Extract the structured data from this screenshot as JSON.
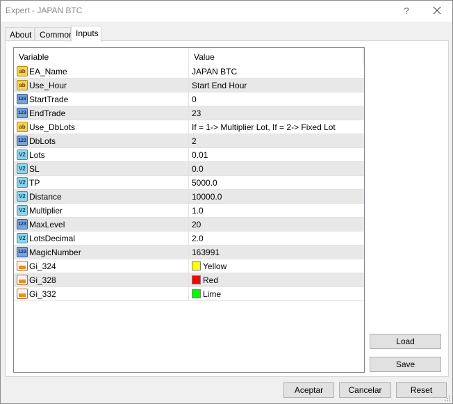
{
  "window": {
    "title": "Expert - JAPAN BTC",
    "help_glyph": "?",
    "close_glyph": "✕"
  },
  "tabs": [
    {
      "label": "About"
    },
    {
      "label": "Common"
    },
    {
      "label": "Inputs"
    }
  ],
  "grid": {
    "headers": {
      "variable": "Variable",
      "value": "Value"
    },
    "rows": [
      {
        "icon": "ab",
        "icon_text": "ab",
        "variable": "EA_Name",
        "value": "JAPAN BTC"
      },
      {
        "icon": "ab",
        "icon_text": "ab",
        "variable": "Use_Hour",
        "value": "Start End Hour"
      },
      {
        "icon": "num",
        "icon_text": "123",
        "variable": "StartTrade",
        "value": "0"
      },
      {
        "icon": "num",
        "icon_text": "123",
        "variable": "EndTrade",
        "value": "23"
      },
      {
        "icon": "ab",
        "icon_text": "ab",
        "variable": "Use_DbLots",
        "value": "If = 1-> Multiplier Lot, If = 2-> Fixed Lot"
      },
      {
        "icon": "num",
        "icon_text": "123",
        "variable": "DbLots",
        "value": "2"
      },
      {
        "icon": "dbl",
        "icon_text": "V2",
        "variable": "Lots",
        "value": "0.01"
      },
      {
        "icon": "dbl",
        "icon_text": "V2",
        "variable": "SL",
        "value": "0.0"
      },
      {
        "icon": "dbl",
        "icon_text": "V2",
        "variable": "TP",
        "value": "5000.0"
      },
      {
        "icon": "dbl",
        "icon_text": "V2",
        "variable": "Distance",
        "value": "10000.0"
      },
      {
        "icon": "dbl",
        "icon_text": "V2",
        "variable": "Multiplier",
        "value": "1.0"
      },
      {
        "icon": "num",
        "icon_text": "123",
        "variable": "MaxLevel",
        "value": "20"
      },
      {
        "icon": "dbl",
        "icon_text": "V2",
        "variable": "LotsDecimal",
        "value": "2.0"
      },
      {
        "icon": "num",
        "icon_text": "123",
        "variable": "MagicNumber",
        "value": "163991"
      },
      {
        "icon": "clr",
        "icon_text": "",
        "variable": "Gi_324",
        "value": "Yellow",
        "swatch": "#ffff00"
      },
      {
        "icon": "clr",
        "icon_text": "",
        "variable": "Gi_328",
        "value": "Red",
        "swatch": "#ff0000"
      },
      {
        "icon": "clr",
        "icon_text": "",
        "variable": "Gi_332",
        "value": "Lime",
        "swatch": "#00ff00"
      }
    ]
  },
  "buttons": {
    "load": "Load",
    "save": "Save",
    "accept": "Aceptar",
    "cancel": "Cancelar",
    "reset": "Reset"
  },
  "icons": {
    "string_type": "string-type-icon",
    "integer_type": "integer-type-icon",
    "double_type": "double-type-icon",
    "color_type": "color-type-icon"
  }
}
